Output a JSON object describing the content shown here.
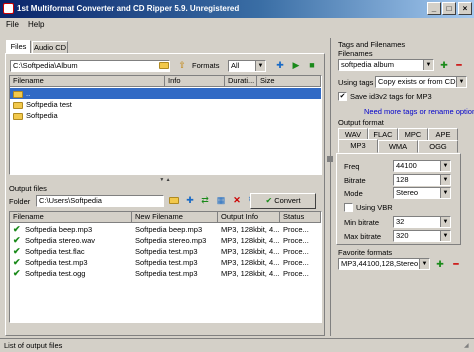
{
  "window": {
    "title": "1st Multiformat Converter and CD Ripper 5.9. Unregistered",
    "minimize": "_",
    "maximize": "□",
    "close": "×"
  },
  "menu": {
    "file": "File",
    "help": "Help"
  },
  "tabs": {
    "files": "Files",
    "audio_cd": "Audio CD"
  },
  "source": {
    "path": "C:\\Softpedia\\Album",
    "formats_label": "Formats",
    "formats_value": "All",
    "columns": [
      "Filename",
      "Info",
      "Durati...",
      "Size"
    ],
    "rows": [
      "..",
      "Softpedia test",
      "Softpedia"
    ]
  },
  "output": {
    "section_label": "Output files",
    "folder_label": "Folder",
    "folder_path": "C:\\Users\\Softpedia",
    "convert_label": "Convert",
    "columns": [
      "Filename",
      "New Filename",
      "Output Info",
      "Status"
    ],
    "rows": [
      {
        "filename": "Softpedia beep.mp3",
        "new_filename": "Softpedia beep.mp3",
        "info": "MP3, 128kbit, 4...",
        "status": "Proce..."
      },
      {
        "filename": "Softpedia stereo.wav",
        "new_filename": "Softpedia stereo.mp3",
        "info": "MP3, 128kbit, 4...",
        "status": "Proce..."
      },
      {
        "filename": "Softpedia test.flac",
        "new_filename": "Softpedia test.mp3",
        "info": "MP3, 128kbit, 4...",
        "status": "Proce..."
      },
      {
        "filename": "Softpedia test.mp3",
        "new_filename": "Softpedia test.mp3",
        "info": "MP3, 128kbit, 4...",
        "status": "Proce..."
      },
      {
        "filename": "Softpedia test.ogg",
        "new_filename": "Softpedia test.mp3",
        "info": "MP3, 128kbit, 4...",
        "status": "Proce..."
      }
    ]
  },
  "tags": {
    "section_label": "Tags and Filenames",
    "filenames_label": "Filenames",
    "filenames_value": "softpedia album",
    "using_tags_label": "Using tags",
    "using_tags_value": "Copy exists or from CD",
    "save_id3_label": "Save id3v2 tags for MP3",
    "more_tags_link": "Need more tags or rename options?"
  },
  "format": {
    "section_label": "Output format",
    "tabs_row1": [
      "WAV",
      "FLAC",
      "MPC",
      "APE"
    ],
    "tabs_row2": [
      "MP3",
      "WMA",
      "OGG"
    ],
    "freq_label": "Freq",
    "freq_value": "44100",
    "bitrate_label": "Bitrate",
    "bitrate_value": "128",
    "mode_label": "Mode",
    "mode_value": "Stereo",
    "vbr_label": "Using VBR",
    "min_bitrate_label": "Min bitrate",
    "min_bitrate_value": "32",
    "max_bitrate_label": "Max bitrate",
    "max_bitrate_value": "320"
  },
  "favorites": {
    "section_label": "Favorite formats",
    "value": "MP3,44100,128,Stereo"
  },
  "status_bar": {
    "text": "List of output files"
  },
  "colors": {
    "title_start": "#0a246a",
    "title_end": "#a6caf0",
    "selection": "#316ac5",
    "link": "#0000cc"
  }
}
